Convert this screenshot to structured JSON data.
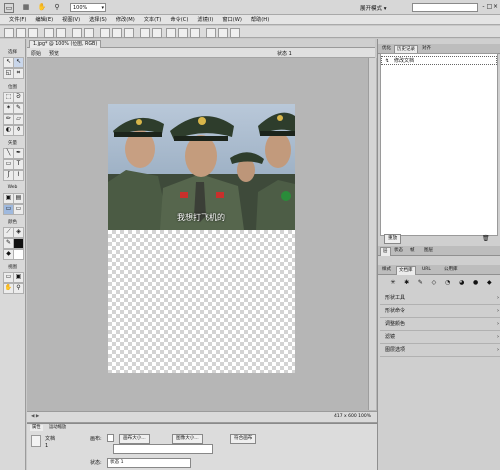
{
  "app_bar": {
    "zoom": "100%",
    "workspace": "展开模式",
    "search_placeholder": "",
    "win_min": "-",
    "win_max": "□",
    "win_close": "×"
  },
  "menus": [
    "文件(F)",
    "编辑(E)",
    "视图(V)",
    "选择(S)",
    "修改(M)",
    "文本(T)",
    "命令(C)",
    "滤镜(I)",
    "窗口(W)",
    "帮助(H)"
  ],
  "document": {
    "tab_label": "1.jpg* @ 100% (位图, RGB)",
    "view_original": "原始",
    "view_preview": "预览",
    "state_label": "状态 1"
  },
  "tools": {
    "sections": [
      "选择",
      "位图",
      "矢量",
      "Web",
      "颜色",
      "视图"
    ]
  },
  "canvas": {
    "caption": "我想打飞机的"
  },
  "status": {
    "frame_info": "417 x 600   100%"
  },
  "properties": {
    "tab1": "属性",
    "tab2": "运动缩放",
    "doc_label": "文档",
    "doc_value": "1",
    "canvas_label": "画布:",
    "canvas_size_btn": "画布大小...",
    "image_size_btn": "图像大小...",
    "fit_canvas_btn": "符合画布",
    "state_label": "状态:",
    "state_value": "状态 1"
  },
  "right_panel": {
    "top_tabs": [
      "优化",
      "历史记录",
      "对齐"
    ],
    "history_items": [
      "修改文档"
    ],
    "reset_btn": "重放",
    "mid_tabs": [
      "层",
      "状态",
      "帧",
      "图层"
    ],
    "assets_tabs": [
      "样式",
      "文档库",
      "URL",
      "公用库"
    ],
    "sections": [
      "形状工具",
      "形状命令",
      "调整颜色",
      "滤镜",
      "图层选项"
    ]
  }
}
